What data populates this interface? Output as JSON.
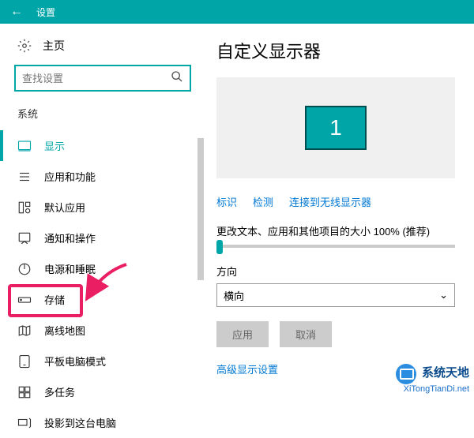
{
  "titlebar": {
    "title": "设置"
  },
  "sidebar": {
    "home": "主页",
    "search_placeholder": "查找设置",
    "section": "系统",
    "items": [
      {
        "label": "显示"
      },
      {
        "label": "应用和功能"
      },
      {
        "label": "默认应用"
      },
      {
        "label": "通知和操作"
      },
      {
        "label": "电源和睡眠"
      },
      {
        "label": "存储"
      },
      {
        "label": "离线地图"
      },
      {
        "label": "平板电脑模式"
      },
      {
        "label": "多任务"
      },
      {
        "label": "投影到这台电脑"
      }
    ]
  },
  "main": {
    "heading": "自定义显示器",
    "monitor_number": "1",
    "links": {
      "identify": "标识",
      "detect": "检测",
      "wireless": "连接到无线显示器"
    },
    "scale_label": "更改文本、应用和其他项目的大小 100% (推荐)",
    "orientation_label": "方向",
    "orientation_value": "横向",
    "apply": "应用",
    "cancel": "取消",
    "advanced": "高级显示设置"
  },
  "watermark": {
    "title": "系统天地",
    "url": "XiTongTianDi.net"
  }
}
